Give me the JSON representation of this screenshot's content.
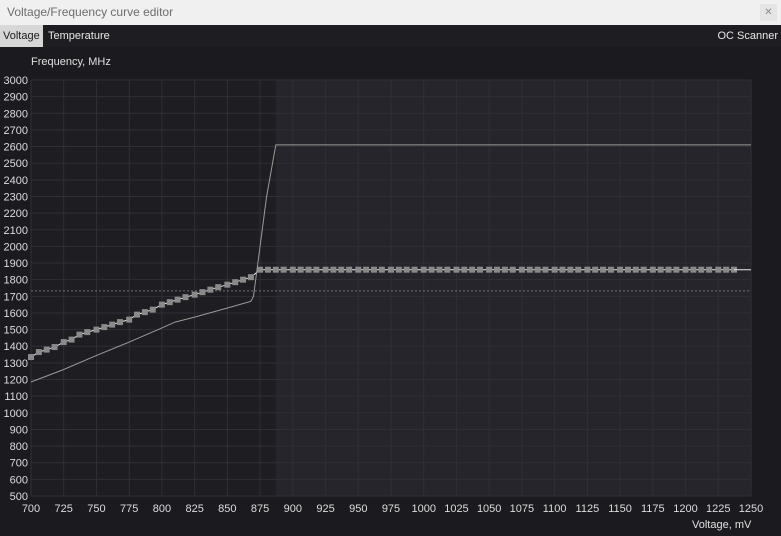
{
  "window": {
    "title": "Voltage/Frequency curve editor",
    "close_icon": "close-icon"
  },
  "tabs": {
    "voltage": "Voltage",
    "temperature": "Temperature",
    "oc_scanner": "OC Scanner"
  },
  "colors": {
    "background": "#1b1b1f",
    "plot_left": "#1d1d22",
    "plot_right": "#25252b",
    "grid": "#2f2f36",
    "curve_points": "#8a8a8a",
    "curve_line": "#e6e6e6",
    "default_curve": "#9a9a9a",
    "ref_line": "#707070"
  },
  "chart_data": {
    "type": "line",
    "xlabel": "Voltage, mV",
    "ylabel": "Frequency, MHz",
    "xlim": [
      700,
      1250
    ],
    "ylim": [
      500,
      3000
    ],
    "x_ticks": [
      700,
      725,
      750,
      775,
      800,
      825,
      850,
      875,
      900,
      925,
      950,
      975,
      1000,
      1025,
      1050,
      1075,
      1100,
      1125,
      1150,
      1175,
      1200,
      1225,
      1250
    ],
    "y_ticks": [
      500,
      600,
      700,
      800,
      900,
      1000,
      1100,
      1200,
      1300,
      1400,
      1500,
      1600,
      1700,
      1800,
      1900,
      2000,
      2100,
      2200,
      2300,
      2400,
      2500,
      2600,
      2700,
      2800,
      2900,
      3000
    ],
    "grid": true,
    "shaded_region_start_x": 887,
    "reference_line_y": 1733,
    "series": [
      {
        "style": "curve-points",
        "x": [
          700,
          706,
          712,
          718,
          725,
          731,
          737,
          743,
          750,
          756,
          762,
          768,
          775,
          781,
          787,
          793,
          800,
          806,
          812,
          818,
          825,
          831,
          837,
          843,
          850,
          856,
          862,
          868,
          875,
          881,
          887,
          893,
          900,
          906,
          912,
          918,
          925,
          931,
          937,
          943,
          950,
          956,
          962,
          968,
          975,
          981,
          987,
          993,
          1000,
          1006,
          1012,
          1018,
          1025,
          1031,
          1037,
          1043,
          1050,
          1056,
          1062,
          1068,
          1075,
          1081,
          1087,
          1093,
          1100,
          1106,
          1112,
          1118,
          1125,
          1131,
          1137,
          1143,
          1150,
          1156,
          1162,
          1168,
          1175,
          1181,
          1187,
          1193,
          1200,
          1206,
          1212,
          1218,
          1225,
          1231,
          1237
        ],
        "y": [
          1335,
          1365,
          1380,
          1395,
          1425,
          1440,
          1470,
          1485,
          1500,
          1515,
          1530,
          1545,
          1560,
          1590,
          1605,
          1620,
          1650,
          1665,
          1680,
          1695,
          1710,
          1725,
          1740,
          1755,
          1770,
          1785,
          1800,
          1815,
          1860,
          1860,
          1860,
          1860,
          1860,
          1860,
          1860,
          1860,
          1860,
          1860,
          1860,
          1860,
          1860,
          1860,
          1860,
          1860,
          1860,
          1860,
          1860,
          1860,
          1860,
          1860,
          1860,
          1860,
          1860,
          1860,
          1860,
          1860,
          1860,
          1860,
          1860,
          1860,
          1860,
          1860,
          1860,
          1860,
          1860,
          1860,
          1860,
          1860,
          1860,
          1860,
          1860,
          1860,
          1860,
          1860,
          1860,
          1860,
          1860,
          1860,
          1860,
          1860,
          1860,
          1860,
          1860,
          1860,
          1860,
          1860,
          1860
        ]
      },
      {
        "style": "default-curve",
        "x": [
          700,
          710,
          725,
          750,
          775,
          800,
          810,
          825,
          850,
          868,
          870,
          880,
          887,
          900,
          1000,
          1100,
          1200,
          1250
        ],
        "y": [
          1185,
          1215,
          1260,
          1345,
          1425,
          1510,
          1545,
          1575,
          1630,
          1670,
          1700,
          2300,
          2610,
          2610,
          2610,
          2610,
          2610,
          2610
        ]
      },
      {
        "style": "offset-line",
        "x": [
          1237,
          1250
        ],
        "y": [
          1860,
          1860
        ]
      }
    ]
  }
}
